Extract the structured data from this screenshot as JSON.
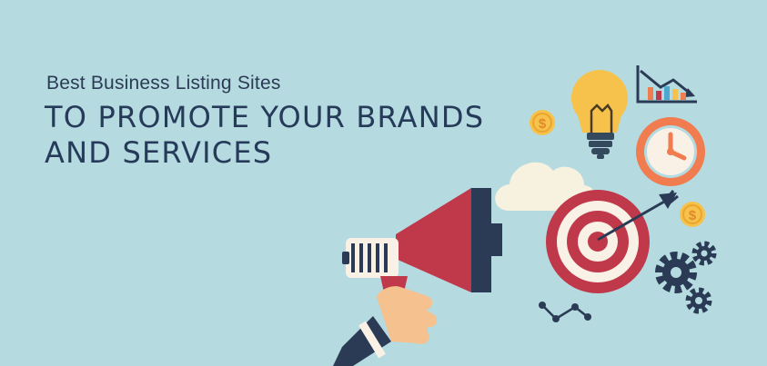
{
  "banner": {
    "subtitle": "Best Business Listing Sites",
    "title_line1": "TO PROMOTE YOUR BRANDS",
    "title_line2": "AND SERVICES"
  },
  "icons": [
    "megaphone-icon",
    "hand-icon",
    "cloud-icon",
    "lightbulb-icon",
    "chart-icon",
    "clock-icon",
    "target-icon",
    "arrow-icon",
    "coin-icon",
    "gear-icon",
    "network-icon"
  ],
  "colors": {
    "background": "#b5dbe0",
    "text": "#263a59",
    "accent_red": "#c0394a",
    "accent_orange": "#f07c4f",
    "accent_yellow": "#f6c24c"
  }
}
